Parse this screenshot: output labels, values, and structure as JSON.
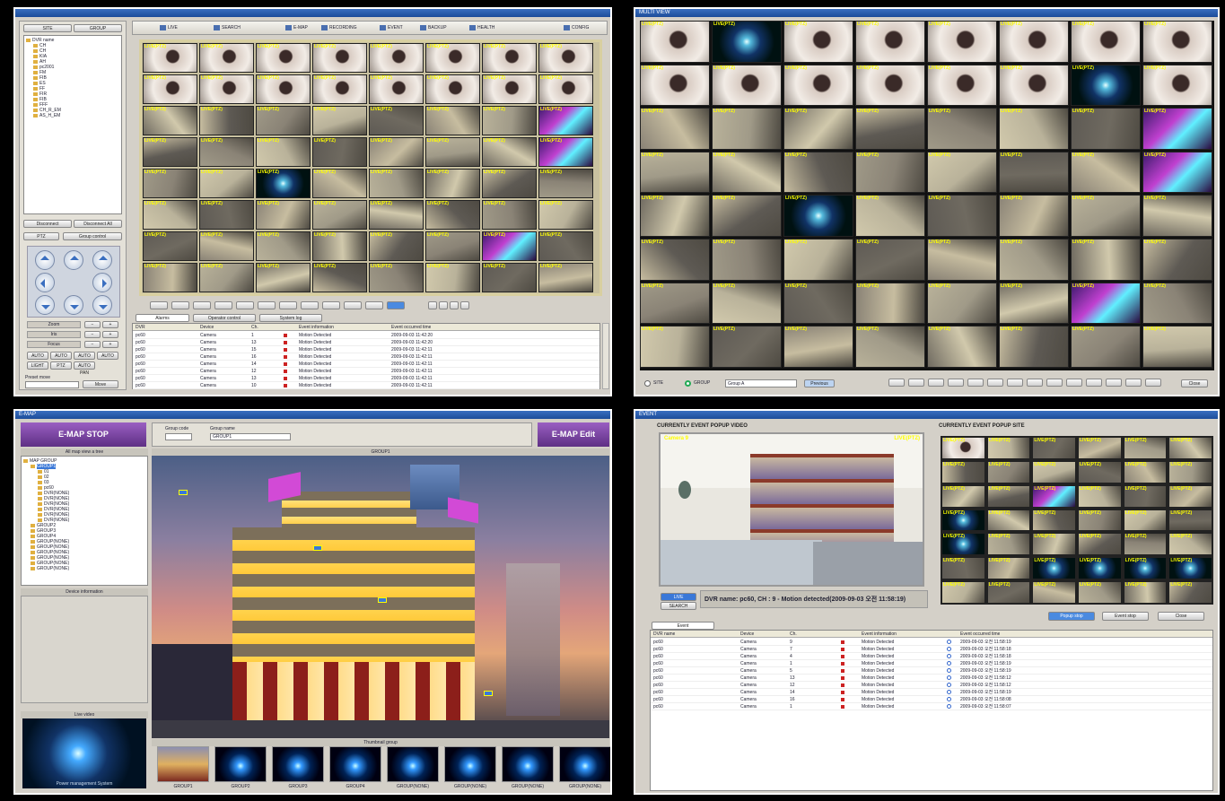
{
  "colors": {
    "label": "#ffff00",
    "accent": "#7b3fa1",
    "select": "#3a78d8"
  },
  "live": {
    "title": "",
    "sidebar_tabs": [
      "SITE",
      "GROUP"
    ],
    "tree_root": "DVR name",
    "tree_items": [
      "CH",
      "CH",
      "KIA",
      "AH",
      "pc2001",
      "FM",
      "FIB",
      "ES",
      "FF",
      "FIR",
      "FIB",
      "FFF",
      "CH_R_EM",
      "AS_H_EM"
    ],
    "left_buttons": [
      "Disconnect",
      "Disconnect All"
    ],
    "ptz_tabs": [
      "PTZ",
      "Group control"
    ],
    "ptz_labels": [
      "Zoom",
      "Iris",
      "Focus"
    ],
    "ptz_small_buttons": [
      "AUTO",
      "AUTO",
      "AUTO",
      "AUTO",
      "LIGHT",
      "PTZ",
      "AUTO PAN"
    ],
    "preset_label": "Preset move",
    "preset_button": "Move",
    "toolbar": [
      "LIVE",
      "SEARCH",
      "E-MAP",
      "RECORDING",
      "EVENT",
      "BACKUP",
      "HEALTH",
      "CONFIG"
    ],
    "camera_label": "LIVE(PTZ)",
    "bottom_tabs": [
      "Alarms",
      "Operator control",
      "System log"
    ],
    "event_headers": [
      "DVR",
      "Device",
      "Ch.",
      "Event information",
      "Event occurred time"
    ],
    "events": [
      {
        "dvr": "pc60",
        "device": "Camera",
        "ch": "1",
        "info": "Motion Detected",
        "time": "2009-09-03 11:42:20"
      },
      {
        "dvr": "pc60",
        "device": "Camera",
        "ch": "13",
        "info": "Motion Detected",
        "time": "2009-09-03 11:42:20"
      },
      {
        "dvr": "pc60",
        "device": "Camera",
        "ch": "15",
        "info": "Motion Detected",
        "time": "2009-09-03 11:42:11"
      },
      {
        "dvr": "pc60",
        "device": "Camera",
        "ch": "16",
        "info": "Motion Detected",
        "time": "2009-09-03 11:42:11"
      },
      {
        "dvr": "pc60",
        "device": "Camera",
        "ch": "14",
        "info": "Motion Detected",
        "time": "2009-09-03 11:42:11"
      },
      {
        "dvr": "pc60",
        "device": "Camera",
        "ch": "12",
        "info": "Motion Detected",
        "time": "2009-09-03 11:42:11"
      },
      {
        "dvr": "pc60",
        "device": "Camera",
        "ch": "13",
        "info": "Motion Detected",
        "time": "2009-09-03 11:42:11"
      },
      {
        "dvr": "pc60",
        "device": "Camera",
        "ch": "10",
        "info": "Motion Detected",
        "time": "2009-09-03 11:42:11"
      }
    ]
  },
  "fullscreen": {
    "title": "MULTI VIEW",
    "camera_label": "LIVE(PTZ)",
    "radio_site": "SITE",
    "radio_group": "GROUP",
    "group_select": "Group A",
    "buttons": [
      "Previous",
      "Close"
    ]
  },
  "emap": {
    "title": "E-MAP",
    "left_badge": "E-MAP STOP",
    "right_badge": "E-MAP Edit",
    "group_code_label": "Group code",
    "group_code_value": "",
    "group_name_label": "Group name",
    "group_name_value": "GROUP1",
    "map_title": "GROUP1",
    "tree_header": "All map view a tree",
    "tree_items": [
      "MAP GROUP",
      "GROUP1",
      "01",
      "02",
      "03",
      "pc60",
      "DVR(NONE)",
      "DVR(NONE)",
      "DVR(NONE)",
      "DVR(NONE)",
      "DVR(NONE)",
      "DVR(NONE)",
      "GROUP2",
      "GROUP3",
      "GROUP4",
      "GROUP(NONE)",
      "GROUP(NONE)",
      "GROUP(NONE)",
      "GROUP(NONE)",
      "GROUP(NONE)",
      "GROUP(NONE)"
    ],
    "device_info_header": "Device information",
    "live_video_header": "Live video",
    "live_video_caption": "Power management System",
    "thumbs_header": "Thumbnail group",
    "thumbs": [
      "GROUP1",
      "GROUP2",
      "GROUP3",
      "GROUP4",
      "GROUP(NONE)",
      "GROUP(NONE)",
      "GROUP(NONE)",
      "GROUP(NONE)"
    ]
  },
  "event": {
    "title": "EVENT",
    "video_header": "CURRENTLY EVENT POPUP VIDEO",
    "site_header": "CURRENTLY EVENT POPUP SITE",
    "camera_label": "LIVE(PTZ)",
    "camera_name": "Camera 9",
    "modes": [
      "LIVE",
      "SEARCH"
    ],
    "status_text": "DVR name: pc60, CH : 9 - Motion detected(2009-09-03 오전 11:58:19)",
    "right_buttons": [
      "Popup stop",
      "Event stop",
      "Close"
    ],
    "tab": "Event",
    "headers": [
      "DVR name",
      "Device",
      "Ch.",
      "Event information",
      "Event occurred time"
    ],
    "events": [
      {
        "dvr": "pc60",
        "device": "Camera",
        "ch": "9",
        "info": "Motion Detected",
        "time": "2009-09-03 오전 11:58:19"
      },
      {
        "dvr": "pc60",
        "device": "Camera",
        "ch": "7",
        "info": "Motion Detected",
        "time": "2009-09-03 오전 11:58:18"
      },
      {
        "dvr": "pc60",
        "device": "Camera",
        "ch": "4",
        "info": "Motion Detected",
        "time": "2009-09-03 오전 11:58:18"
      },
      {
        "dvr": "pc60",
        "device": "Camera",
        "ch": "1",
        "info": "Motion Detected",
        "time": "2009-09-03 오전 11:58:19"
      },
      {
        "dvr": "pc60",
        "device": "Camera",
        "ch": "5",
        "info": "Motion Detected",
        "time": "2009-09-03 오전 11:58:19"
      },
      {
        "dvr": "pc60",
        "device": "Camera",
        "ch": "13",
        "info": "Motion Detected",
        "time": "2009-09-03 오전 11:58:12"
      },
      {
        "dvr": "pc60",
        "device": "Camera",
        "ch": "12",
        "info": "Motion Detected",
        "time": "2009-09-03 오전 11:58:12"
      },
      {
        "dvr": "pc60",
        "device": "Camera",
        "ch": "14",
        "info": "Motion Detected",
        "time": "2009-09-03 오전 11:58:19"
      },
      {
        "dvr": "pc60",
        "device": "Camera",
        "ch": "16",
        "info": "Motion Detected",
        "time": "2009-09-03 오전 11:58:08"
      },
      {
        "dvr": "pc60",
        "device": "Camera",
        "ch": "1",
        "info": "Motion Detected",
        "time": "2009-09-03 오전 11:58:07"
      }
    ]
  }
}
